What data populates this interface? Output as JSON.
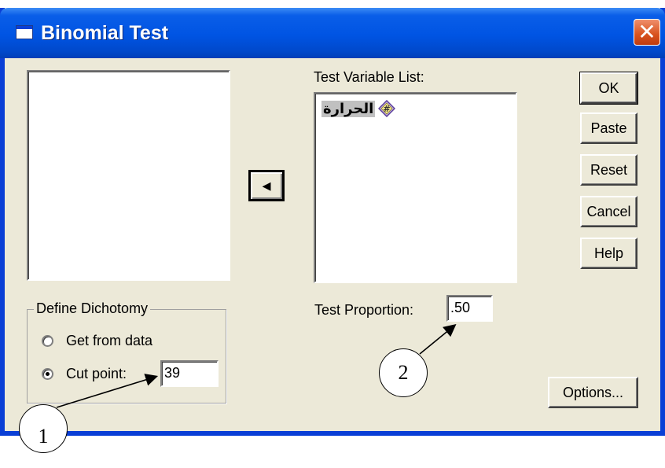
{
  "window": {
    "title": "Binomial Test",
    "close_glyph": "✕"
  },
  "test_variable_list": {
    "label": "Test Variable List:",
    "items": [
      {
        "icon": "scale-variable-icon",
        "label": "الحرارة"
      }
    ]
  },
  "move_button": {
    "glyph": "◂",
    "icon": "left-arrow-icon"
  },
  "buttons": {
    "ok": "OK",
    "paste": "Paste",
    "reset": "Reset",
    "cancel": "Cancel",
    "help": "Help",
    "options": "Options..."
  },
  "define_dichotomy": {
    "legend": "Define Dichotomy",
    "get_from_data": "Get from data",
    "cut_point_label": "Cut point:",
    "cut_point_value": "39",
    "selected": "cut_point"
  },
  "test_proportion": {
    "label": "Test Proportion:",
    "value": ".50"
  },
  "annotations": [
    {
      "number": "1"
    },
    {
      "number": "2"
    }
  ]
}
